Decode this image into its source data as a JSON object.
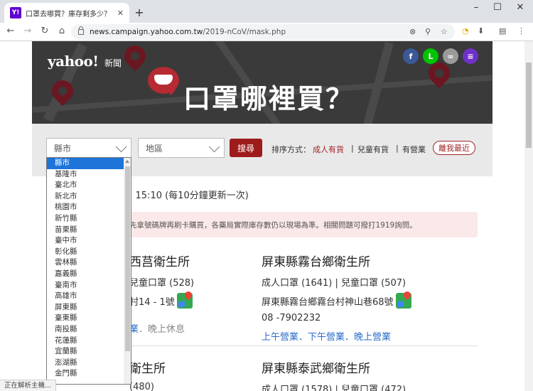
{
  "browser": {
    "tab_title": "口罩去哪買？庫存剩多少？Yahoo",
    "tab_favicon": "Y!",
    "url_domain": "news.campaign.yahoo.com.tw",
    "url_path": "/2019-nCoV/mask.php",
    "icons": [
      "back-icon",
      "forward-icon",
      "reload-icon",
      "home-icon",
      "lock-icon",
      "zoom-icon",
      "star-icon",
      "menu-icon"
    ]
  },
  "hero": {
    "logo": "yahoo!",
    "logo_sub": "新聞",
    "title": "口罩哪裡買？",
    "social": [
      {
        "label": "f",
        "color": "#3b5998"
      },
      {
        "label": "L",
        "color": "#00c300"
      },
      {
        "label": "∞",
        "color": "#9a9a9a"
      },
      {
        "label": "≡",
        "color": "#6e31c6"
      }
    ]
  },
  "filters": {
    "county_placeholder": "縣市",
    "district_placeholder": "地區",
    "search_label": "搜尋",
    "sort_label": "排序方式：",
    "sort_options": [
      "成人有貨",
      "兒童有貨",
      "有營業"
    ],
    "nearest_label": "離我最近"
  },
  "update_time": "15:10 (每10分鐘更新一次)",
  "notice": "先拿號碼牌再刷卡購買，各藥局實際庫存數仍以現場為準。相關問題可撥打1919詢問。",
  "cards": [
    {
      "name": "西莒衛生所",
      "stock": "兒童口罩 (528)",
      "address": "村14 - 1號",
      "phone": "",
      "hours_open": "業",
      "hours_closed": "晚上休息"
    },
    {
      "name": "屏東縣霧台鄉衛生所",
      "stock": "成人口罩 (1641) | 兒童口罩 (507)",
      "address": "屏東縣霧台鄉霧台村神山巷68號",
      "phone": "08 -7902232",
      "hours_open": "上午營業．下午營業．晚上營業",
      "hours_closed": ""
    },
    {
      "name": "衛生所",
      "stock": "(480)",
      "address": "",
      "phone": "",
      "hours_open": "",
      "hours_closed": ""
    },
    {
      "name": "屏東縣泰武鄉衛生所",
      "stock": "成人口罩 (1578) | 兒童口罩 (472)",
      "address": "",
      "phone": "",
      "hours_open": "",
      "hours_closed": ""
    }
  ],
  "dropdown": {
    "selected": "縣市",
    "items": [
      "縣市",
      "基隆市",
      "臺北市",
      "新北市",
      "桃園市",
      "新竹縣",
      "苗栗縣",
      "臺中市",
      "彰化縣",
      "雲林縣",
      "嘉義縣",
      "臺南市",
      "高雄市",
      "屏東縣",
      "臺東縣",
      "南投縣",
      "花蓮縣",
      "宜蘭縣",
      "澎湖縣",
      "金門縣"
    ]
  },
  "status_bar": "正在解析主機..."
}
